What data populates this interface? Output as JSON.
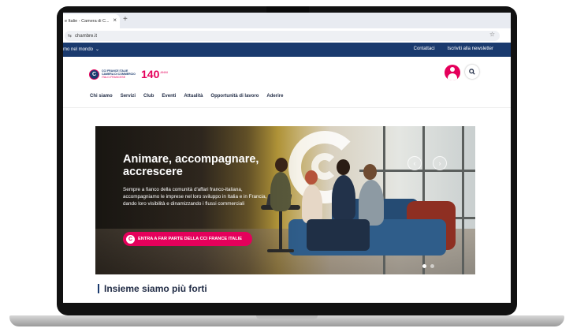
{
  "browser": {
    "tab_title": "e Italie - Camera di C...",
    "tab_close": "×",
    "new_tab": "+",
    "url": "chambre.it"
  },
  "site": {
    "topbar": {
      "world_menu": "mo nel mondo",
      "links": [
        "Contattaci",
        "Iscriviti alla newsletter"
      ]
    },
    "logo": {
      "mark": "C",
      "line1": "CCI FRANCE ITALIE",
      "line2": "CAMERA DI COMMERCIO",
      "line3": "ITALO-FRANCESE",
      "anniversary": "140",
      "anniversary_sup": "ANNI"
    },
    "nav": [
      "Chi siamo",
      "Servizi",
      "Club",
      "Eventi",
      "Attualità",
      "Opportunità di lavoro",
      "Aderire"
    ],
    "hero": {
      "title": "Animare, accompagnare, accrescere",
      "text": "Sempre a fianco della comunità d'affari franco-italiana, accompagniamo le imprese nel loro sviluppo in Italia e in Francia, dando loro visibilità e dinamizzando i flussi commerciali",
      "cta": "ENTRA A FAR PARTE DELLA CCI FRANCE ITALIE",
      "cta_logo": "C",
      "prev": "‹",
      "next": "›"
    },
    "section_title": "Insieme siamo più forti"
  },
  "colors": {
    "brand_navy": "#1a3a6e",
    "brand_pink": "#e5005b"
  },
  "icons": [
    "tune-icon",
    "star-icon",
    "chevron-down-icon",
    "user-icon",
    "search-icon",
    "arrow-left-icon",
    "arrow-right-icon"
  ]
}
